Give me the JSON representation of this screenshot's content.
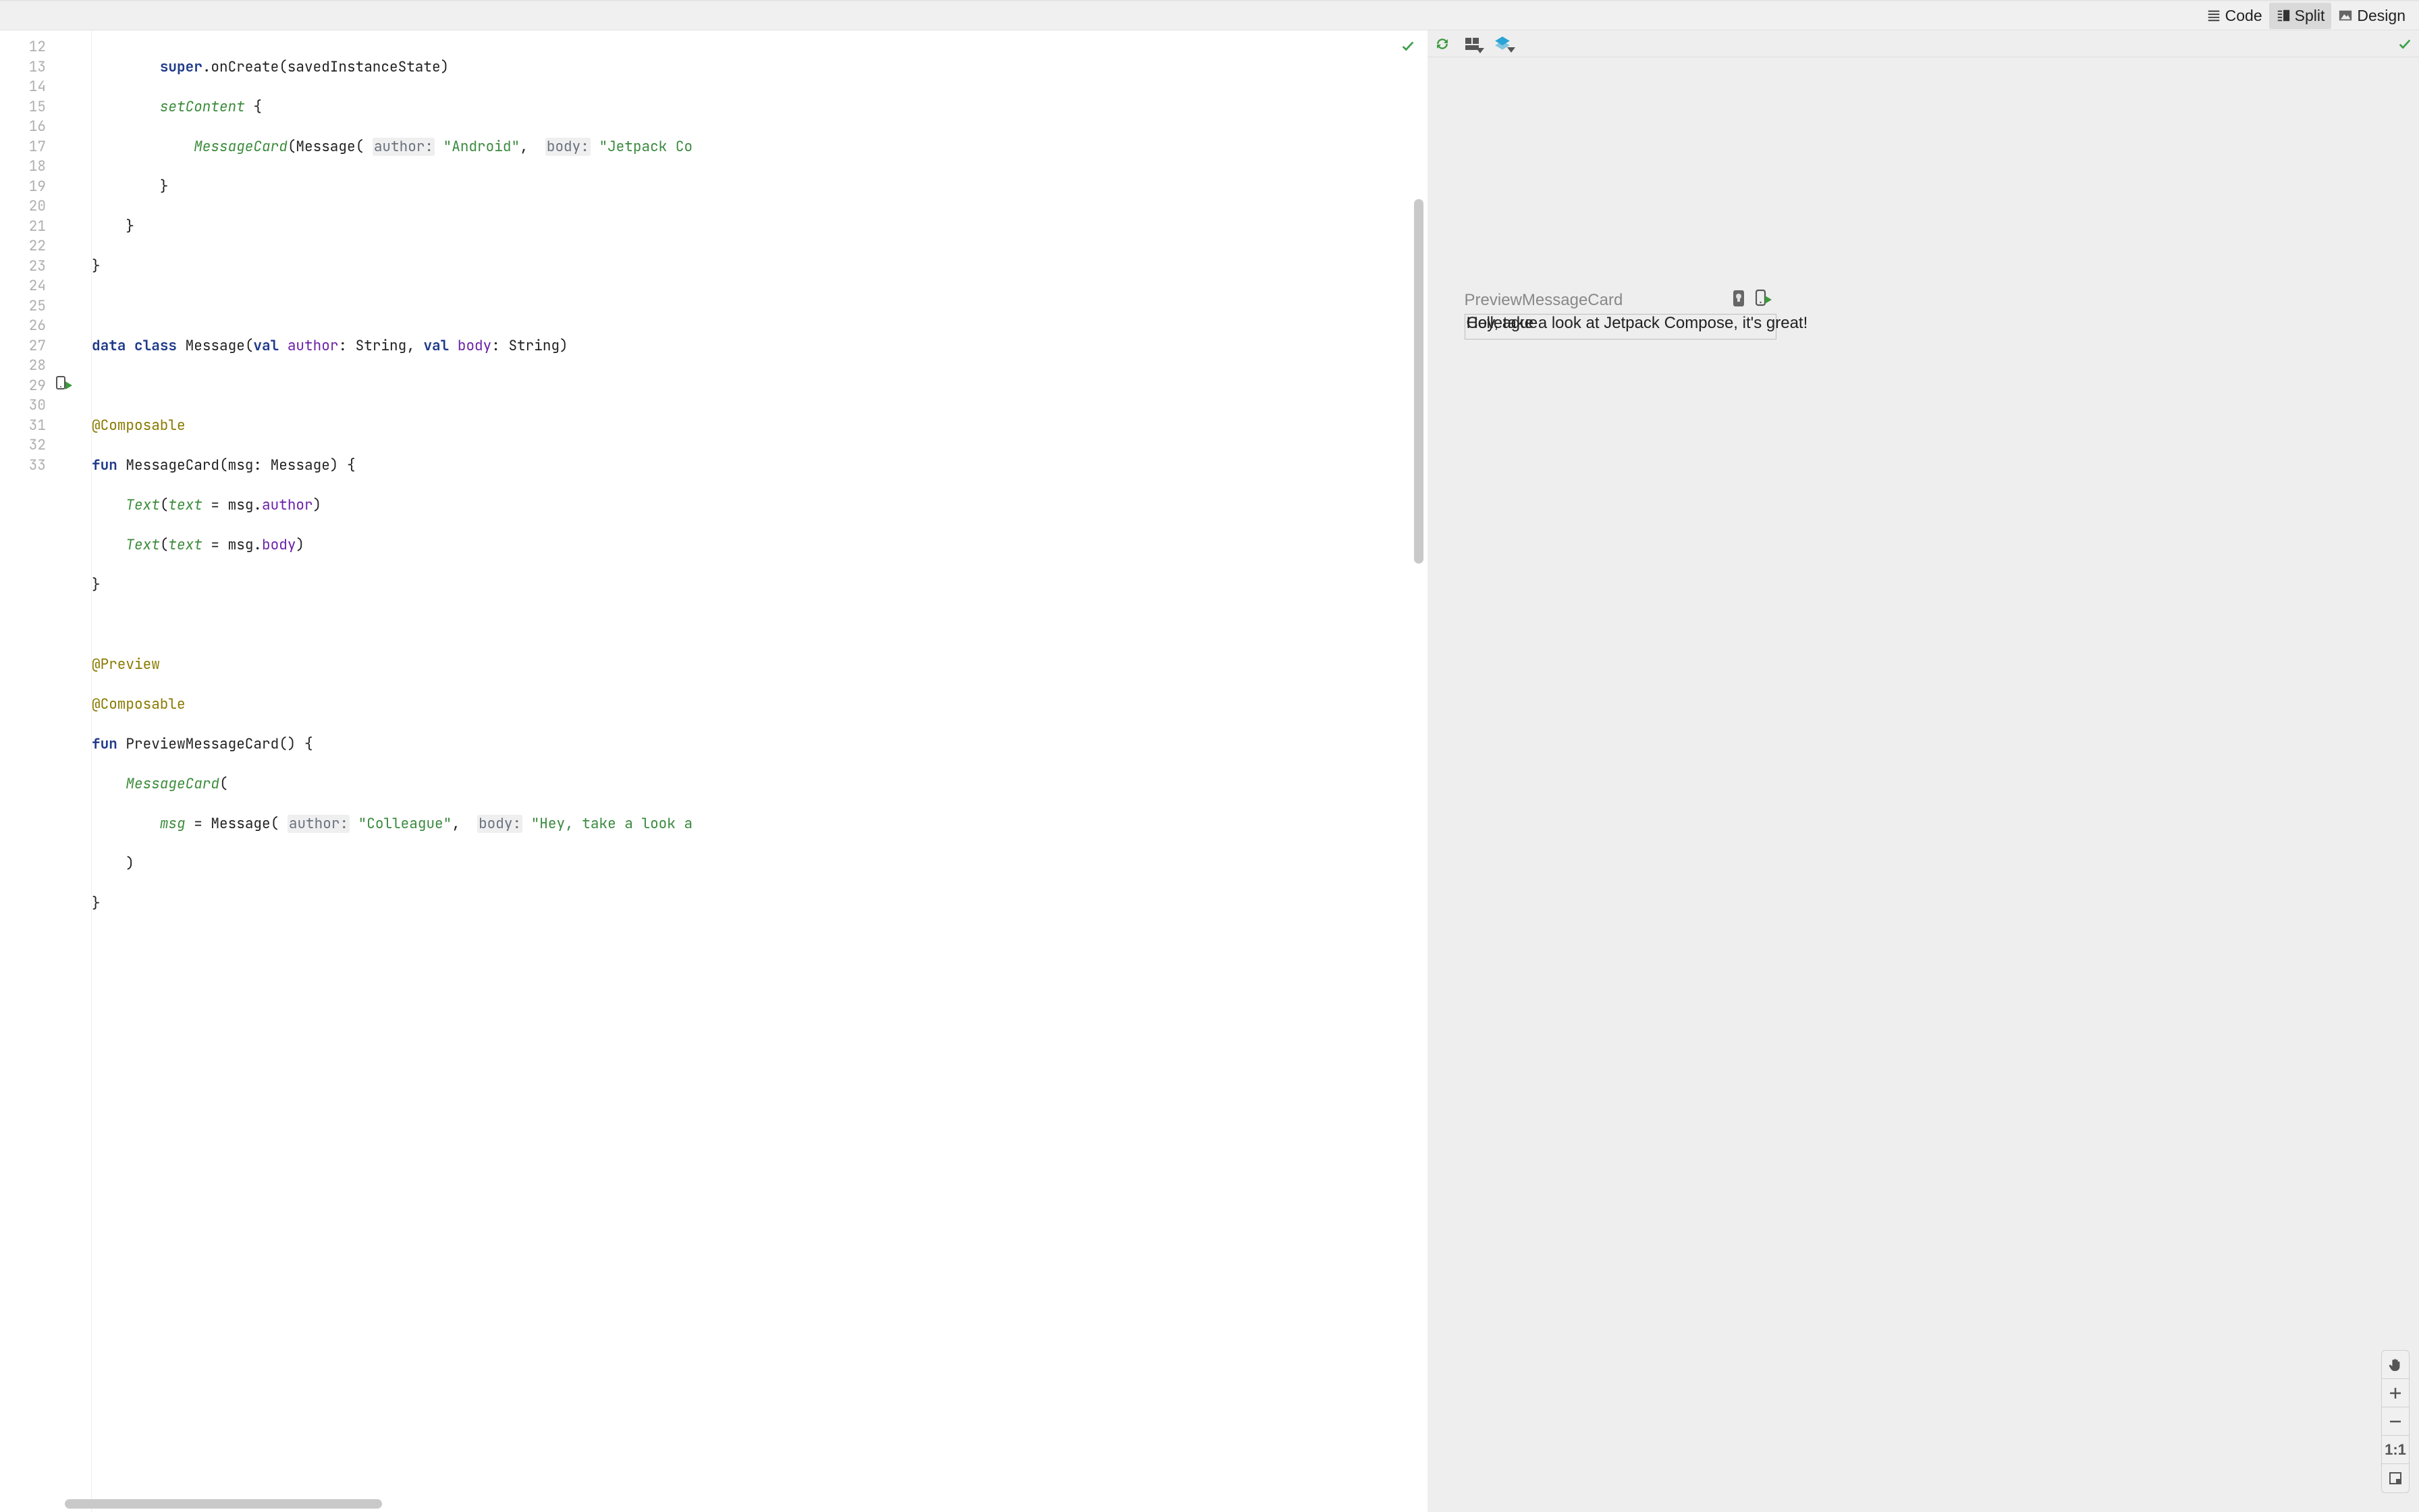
{
  "toolbar": {
    "code_label": "Code",
    "split_label": "Split",
    "design_label": "Design",
    "selected": "split"
  },
  "editor": {
    "first_line": 12,
    "last_line": 33,
    "run_icon_line": 29,
    "lines": {
      "l12a": "super",
      "l12b": ".onCreate(savedInstanceState)",
      "l13a": "setContent",
      "l13b": " {",
      "l14a": "MessageCard",
      "l14b": "(Message(",
      "l14_author_hint": "author:",
      "l14_author_val": "\"Android\"",
      "l14_sep": ",  ",
      "l14_body_hint": "body:",
      "l14_body_val": "\"Jetpack Co",
      "l15": "}",
      "l16": "}",
      "l17": "}",
      "l19_data": "data",
      "l19_class": "class",
      "l19_name": " Message(",
      "l19_val1": "val",
      "l19_author": " author",
      "l19_colon1": ": String, ",
      "l19_val2": "val",
      "l19_body": " body",
      "l19_colon2": ": String)",
      "l21_anno": "@Composable",
      "l22_fun": "fun",
      "l22_name": " MessageCard(msg: Message) {",
      "l23_text": "Text",
      "l23_open": "(",
      "l23_arg": "text",
      "l23_eq": " = msg.",
      "l23_prop": "author",
      "l23_close": ")",
      "l24_text": "Text",
      "l24_open": "(",
      "l24_arg": "text",
      "l24_eq": " = msg.",
      "l24_prop": "body",
      "l24_close": ")",
      "l25": "}",
      "l27_anno": "@Preview",
      "l28_anno": "@Composable",
      "l29_fun": "fun",
      "l29_name": " PreviewMessageCard() {",
      "l30_call": "MessageCard",
      "l30_open": "(",
      "l31_arg": "msg",
      "l31_eq": " = Message(",
      "l31_author_hint": "author:",
      "l31_author_val": "\"Colleague\"",
      "l31_sep": ",  ",
      "l31_body_hint": "body:",
      "l31_body_val": "\"Hey, take a look a",
      "l32": ")",
      "l33": "}"
    }
  },
  "preview": {
    "label": "PreviewMessageCard",
    "text_overlay_author": "Colleague",
    "render_text": "Hey, take a look at Jetpack Compose, it's great!",
    "zoom_1to1_label": "1:1"
  }
}
